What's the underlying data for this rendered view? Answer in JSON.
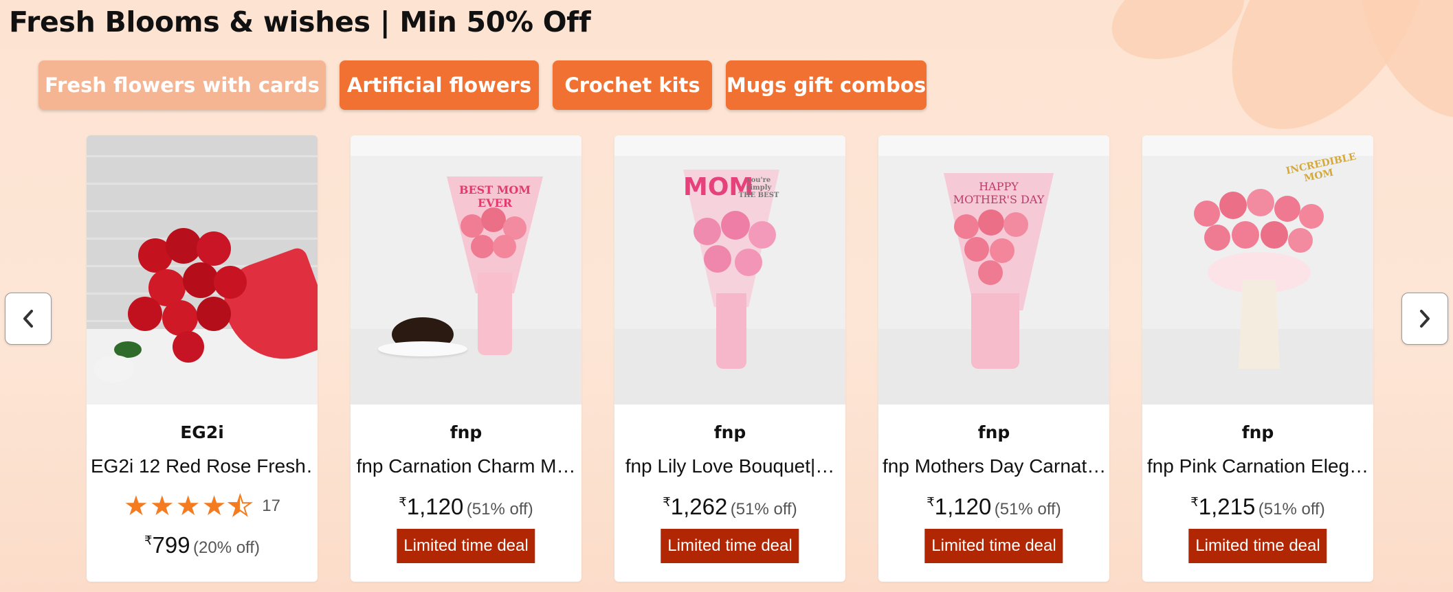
{
  "header": {
    "title": "Fresh Blooms & wishes | Min 50% Off"
  },
  "chips": [
    {
      "label": "Fresh flowers with cards",
      "active": true
    },
    {
      "label": "Artificial flowers"
    },
    {
      "label": "Crochet kits"
    },
    {
      "label": "Mugs gift combos"
    }
  ],
  "products": [
    {
      "brand": "EG2i",
      "name": "EG2i 12 Red Rose Fresh…",
      "rating_stars": 4.5,
      "rating_count": "17",
      "currency": "₹",
      "price": "799",
      "discount": "(20% off)"
    },
    {
      "brand": "fnp",
      "name": "fnp Carnation Charm M…",
      "currency": "₹",
      "price": "1,120",
      "discount": "(51% off)",
      "deal": "Limited time deal",
      "card_text": "BEST MOM EVER"
    },
    {
      "brand": "fnp",
      "name": "fnp Lily Love Bouquet|…",
      "currency": "₹",
      "price": "1,262",
      "discount": "(51% off)",
      "deal": "Limited time deal",
      "card_text": "MOM",
      "card_subtext": "you're simply THE BEST"
    },
    {
      "brand": "fnp",
      "name": "fnp Mothers Day Carnat…",
      "currency": "₹",
      "price": "1,120",
      "discount": "(51% off)",
      "deal": "Limited time deal",
      "card_text": "HAPPY MOTHER'S DAY"
    },
    {
      "brand": "fnp",
      "name": "fnp Pink Carnation Eleg…",
      "currency": "₹",
      "price": "1,215",
      "discount": "(51% off)",
      "deal": "Limited time deal",
      "card_text": "INCREDIBLE MOM"
    }
  ],
  "nav": {
    "prev_icon": "chevron-left-icon",
    "next_icon": "chevron-right-icon"
  },
  "colors": {
    "chip": "#f07131",
    "chip_active": "#f5b592",
    "deal": "#b12704",
    "star": "#f47b20"
  }
}
